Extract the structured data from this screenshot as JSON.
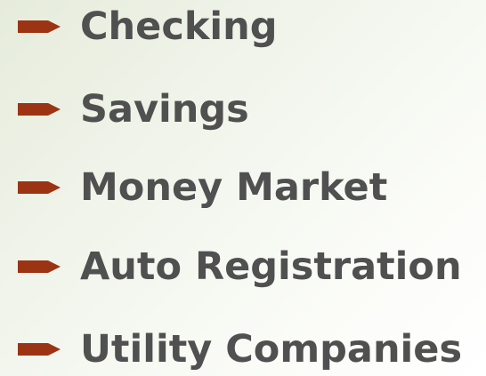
{
  "bullet_icon": "arrow-bullet-icon",
  "bullet_color": "#9c3413",
  "text_color": "#505050",
  "items": [
    {
      "label": "Checking"
    },
    {
      "label": "Savings"
    },
    {
      "label": "Money Market"
    },
    {
      "label": "Auto Registration"
    },
    {
      "label": "Utility Companies"
    }
  ]
}
